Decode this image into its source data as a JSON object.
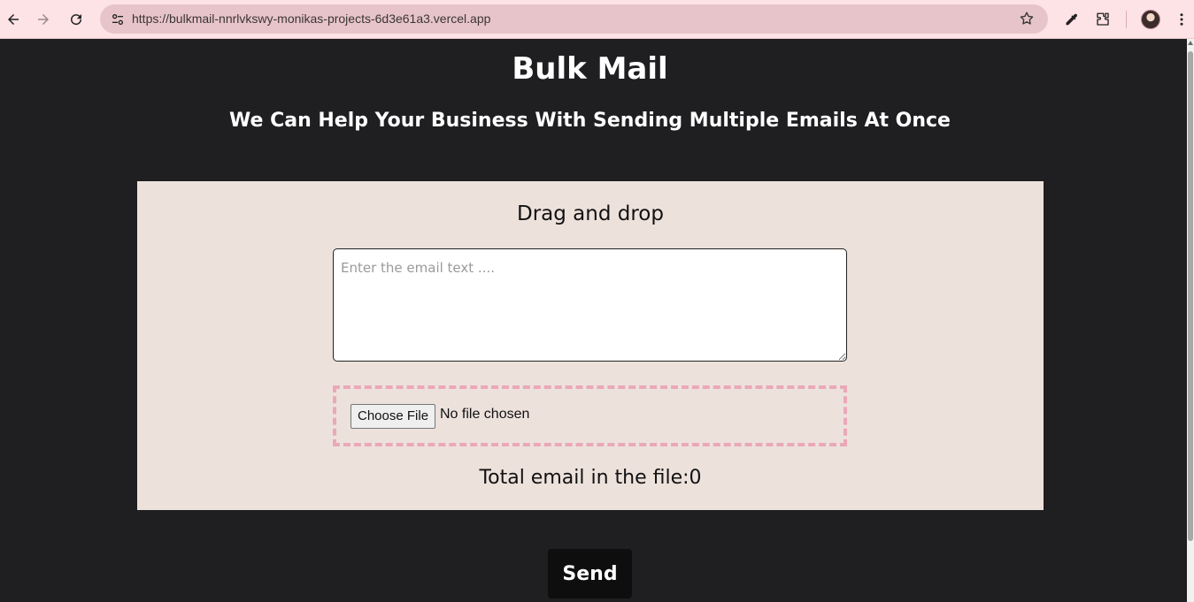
{
  "browser": {
    "url": "https://bulkmail-nnrlvkswy-monikas-projects-6d3e61a3.vercel.app",
    "icons": [
      "back-icon",
      "forward-icon",
      "reload-icon",
      "site-info-icon",
      "bookmark-star-icon",
      "eyedropper-icon",
      "extensions-icon",
      "profile-avatar",
      "more-menu-icon"
    ],
    "toolbar_color": "#fde2e6",
    "omnibox_color": "#e7c4ca"
  },
  "page": {
    "title": "Bulk Mail",
    "subtitle": "We Can Help Your Business With Sending Multiple Emails At Once",
    "background_color": "#1f1e20"
  },
  "panel": {
    "heading": "Drag and drop",
    "textarea_placeholder": "Enter the email text ....",
    "textarea_value": "",
    "file_button_label": "Choose File",
    "file_status": "No file chosen",
    "total_label": "Total email in the file:0",
    "panel_color": "#ede1dc",
    "dropzone_border_color": "#eaa8b8"
  },
  "actions": {
    "send_label": "Send"
  }
}
